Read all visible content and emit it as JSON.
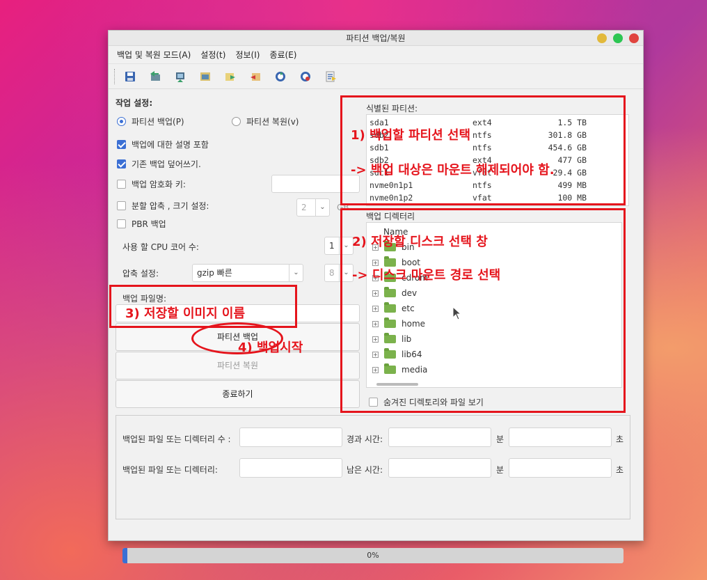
{
  "window": {
    "title": "파티션 백업/복원"
  },
  "menu": [
    "백업 및 복원 모드(A)",
    "설정(t)",
    "정보(I)",
    "종료(E)"
  ],
  "toolbar_icons": [
    "save-icon",
    "backup-icon",
    "restore-icon",
    "image-icon",
    "export-icon",
    "import-icon",
    "refresh-icon",
    "stop-icon",
    "log-icon"
  ],
  "settings": {
    "heading": "작업 설정:",
    "radio_backup": "파티션 백업(P)",
    "radio_restore": "파티션 복원(v)",
    "chk_description": "백업에 대한 설명 포함",
    "chk_overwrite": "기존 백업 덮어쓰기.",
    "chk_encrypt": "백업 암호화 키:",
    "chk_split": "분할 압축 , 크기 설정:",
    "split_value": "2",
    "split_unit": "GB",
    "chk_pbr": "PBR 백업",
    "cpu_label": "사용 할 CPU 코어 수:",
    "cpu_value": "1",
    "compress_label": "압축 설정:",
    "compress_value": "gzip 빠른",
    "compress_level": "8",
    "filename_label": "백업 파일명:"
  },
  "buttons": {
    "backup": "파티션 백업",
    "restore": "파티션 복원",
    "exit": "종료하기"
  },
  "partitions": {
    "label": "식별된 파티션:",
    "rows": [
      {
        "dev": "sda1",
        "fs": "ext4",
        "size": "1.5 TB"
      },
      {
        "dev": "sdb2",
        "fs": "ntfs",
        "size": "301.8 GB"
      },
      {
        "dev": "sdb1",
        "fs": "ntfs",
        "size": "454.6 GB"
      },
      {
        "dev": "sdb2",
        "fs": "ext4",
        "size": "477 GB"
      },
      {
        "dev": "sdc1",
        "fs": "vfat",
        "size": "29.4 GB"
      },
      {
        "dev": "nvme0n1p1",
        "fs": "ntfs",
        "size": "499 MB"
      },
      {
        "dev": "nvme0n1p2",
        "fs": "vfat",
        "size": "100 MB"
      }
    ]
  },
  "directory": {
    "label": "백업 디렉터리",
    "column": "Name",
    "items": [
      "bin",
      "boot",
      "cdrom",
      "dev",
      "etc",
      "home",
      "lib",
      "lib64",
      "media"
    ],
    "show_hidden": "숨겨진 디렉토리와 파일 보기"
  },
  "status": {
    "count_label": "백업된 파일 또는 디렉터리 수 :",
    "file_label": "백업된 파일 또는 디렉터리:",
    "elapsed_label": "경과 시간:",
    "remaining_label": "남은 시간:",
    "min": "분",
    "sec": "초",
    "progress_text": "0%",
    "progress_value": 0.01
  },
  "annotations": {
    "a1": "1) 백업할 파티션 선택",
    "a1b": "-> 백업 대상은 마운트 해제되어야 함.",
    "a2": "2) 저장할 디스크 선택 창",
    "a2b": "-> 디스크 마운트 경로 선택",
    "a3": "3) 저장할 이미지 이름",
    "a4": "4) 백업시작"
  },
  "colors": {
    "accent": "#3b6fd4",
    "annotation": "#e5141c"
  }
}
